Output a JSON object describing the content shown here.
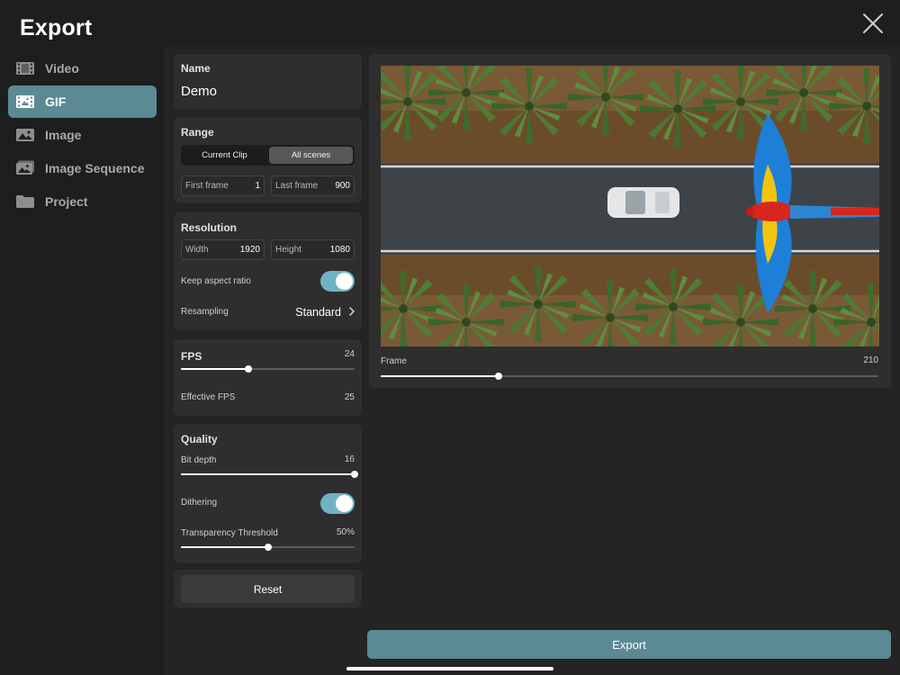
{
  "header": {
    "title": "Export"
  },
  "sidebar": {
    "items": [
      {
        "label": "Video",
        "icon": "film-icon",
        "active": false
      },
      {
        "label": "GIF",
        "icon": "gif-image-icon",
        "active": true
      },
      {
        "label": "Image",
        "icon": "image-icon",
        "active": false
      },
      {
        "label": "Image Sequence",
        "icon": "image-sequence-icon",
        "active": false
      },
      {
        "label": "Project",
        "icon": "folder-icon",
        "active": false
      }
    ]
  },
  "name_card": {
    "title": "Name",
    "value": "Demo"
  },
  "range_card": {
    "title": "Range",
    "segments": [
      "Current Clip",
      "All scenes"
    ],
    "selected_segment": "All scenes",
    "first_frame": {
      "label": "First frame",
      "value": "1"
    },
    "last_frame": {
      "label": "Last frame",
      "value": "900"
    }
  },
  "resolution_card": {
    "title": "Resolution",
    "width": {
      "label": "Width",
      "value": "1920"
    },
    "height": {
      "label": "Height",
      "value": "1080"
    },
    "keep_aspect": {
      "label": "Keep aspect ratio",
      "on": true
    },
    "resampling": {
      "label": "Resampling",
      "value": "Standard"
    }
  },
  "fps_card": {
    "title": "FPS",
    "value": "24",
    "slider_fraction": 0.39,
    "effective_label": "Effective FPS",
    "effective_value": "25"
  },
  "quality_card": {
    "title": "Quality",
    "bit_depth": {
      "label": "Bit depth",
      "value": "16",
      "slider_fraction": 1.0
    },
    "dithering": {
      "label": "Dithering",
      "on": true
    },
    "transparency": {
      "label": "Transparency Threshold",
      "value": "50%",
      "slider_fraction": 0.5
    }
  },
  "reset": {
    "label": "Reset"
  },
  "preview": {
    "frame_label": "Frame",
    "frame_value": "210",
    "frame_fraction": 0.237
  },
  "export": {
    "label": "Export"
  },
  "colors": {
    "accent": "#5b8a94",
    "toggle_on": "#6fb3c2",
    "background": "#1e1e1e",
    "card": "#2e2e2e"
  }
}
